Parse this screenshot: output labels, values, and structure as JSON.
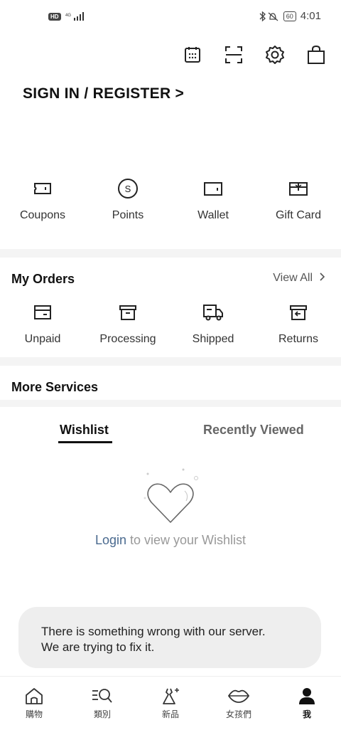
{
  "status_bar": {
    "signal": "HD 4G",
    "time": "4:01",
    "battery": "60"
  },
  "top_icons": [
    "calendar-icon",
    "scan-icon",
    "gear-icon",
    "shopping-bag-icon"
  ],
  "account": {
    "signin_label": "SIGN IN / REGISTER >"
  },
  "assets": [
    {
      "label": "Coupons",
      "icon": "coupon-icon"
    },
    {
      "label": "Points",
      "icon": "points-icon"
    },
    {
      "label": "Wallet",
      "icon": "wallet-icon"
    },
    {
      "label": "Gift Card",
      "icon": "gift-card-icon"
    }
  ],
  "orders": {
    "title": "My Orders",
    "view_all": "View All",
    "items": [
      {
        "label": "Unpaid",
        "icon": "unpaid-icon"
      },
      {
        "label": "Processing",
        "icon": "processing-icon"
      },
      {
        "label": "Shipped",
        "icon": "truck-icon"
      },
      {
        "label": "Returns",
        "icon": "returns-icon"
      }
    ]
  },
  "services": {
    "title": "More Services"
  },
  "tabs": [
    {
      "label": "Wishlist",
      "active": true
    },
    {
      "label": "Recently Viewed",
      "active": false
    }
  ],
  "wishlist_empty": {
    "login_label": "Login",
    "message": "to view your Wishlist"
  },
  "toast": {
    "line1": "There is something wrong with our server.",
    "line2": "We are trying to fix it."
  },
  "bottom_nav": [
    {
      "label": "購物",
      "icon": "home-icon"
    },
    {
      "label": "類別",
      "icon": "category-search-icon"
    },
    {
      "label": "新品",
      "icon": "new-dress-icon"
    },
    {
      "label": "女孩們",
      "icon": "lips-icon"
    },
    {
      "label": "我",
      "icon": "profile-icon",
      "active": true
    }
  ]
}
